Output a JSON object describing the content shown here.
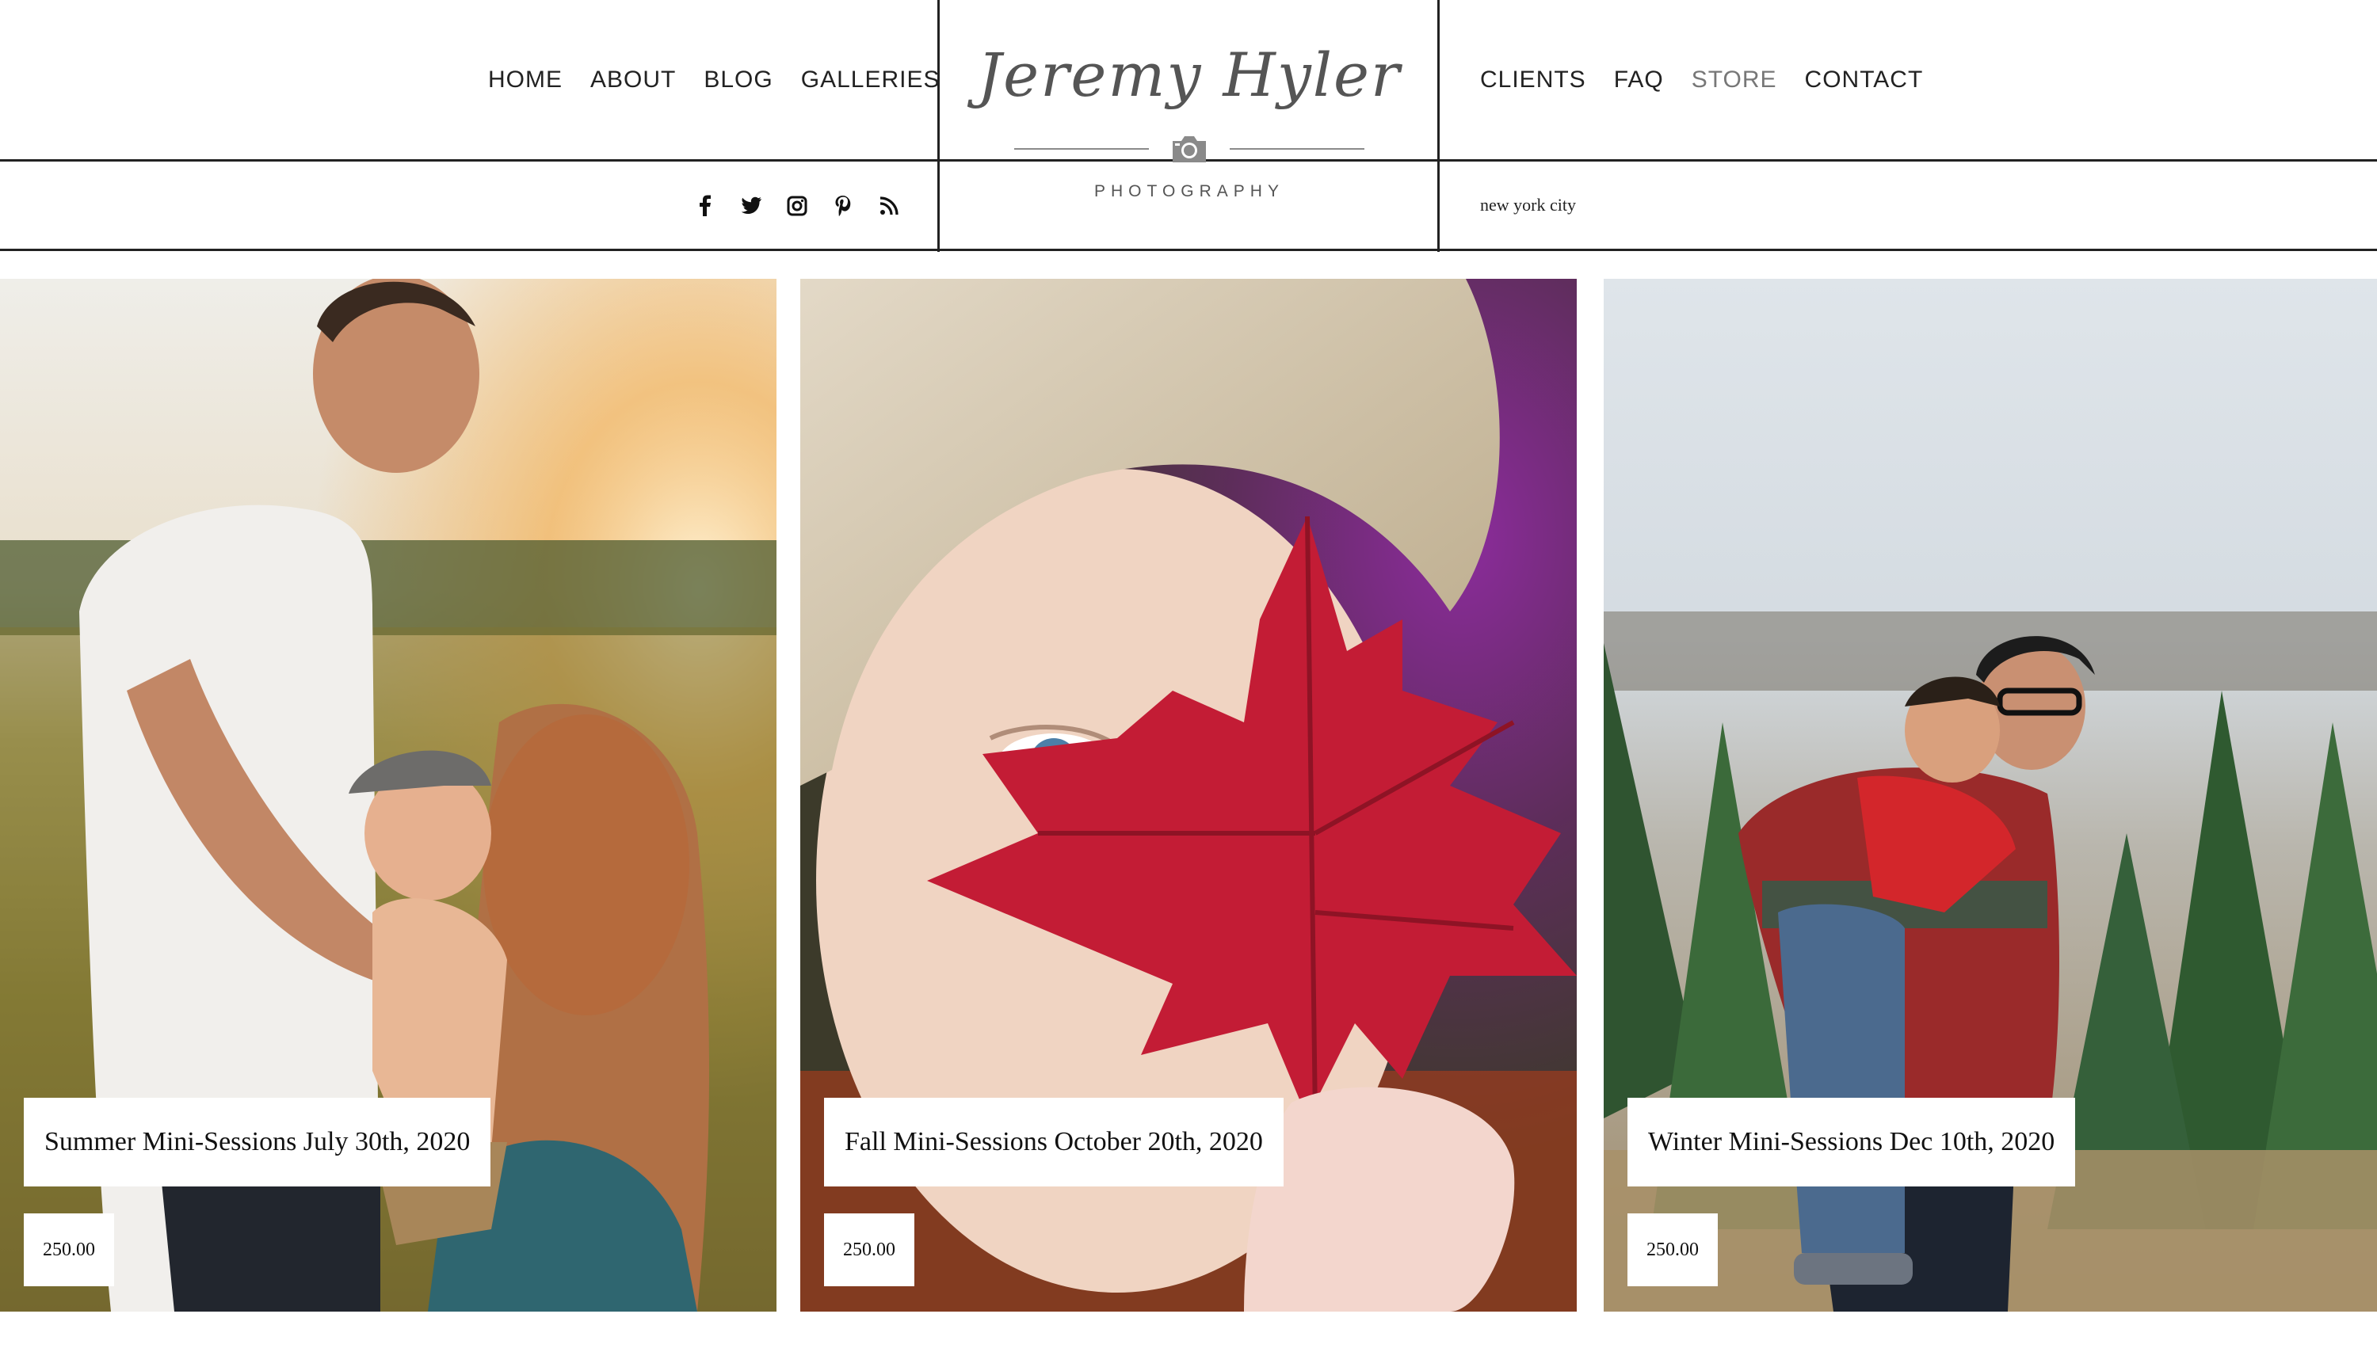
{
  "brand": {
    "script": "Jeremy Hyler",
    "subtitle": "PHOTOGRAPHY",
    "icon": "camera-icon"
  },
  "nav_left": [
    {
      "label": "HOME"
    },
    {
      "label": "ABOUT"
    },
    {
      "label": "BLOG"
    },
    {
      "label": "GALLERIES"
    }
  ],
  "nav_right": [
    {
      "label": "CLIENTS"
    },
    {
      "label": "FAQ"
    },
    {
      "label": "STORE",
      "active": true
    },
    {
      "label": "CONTACT"
    }
  ],
  "social_icons": [
    "facebook-icon",
    "twitter-icon",
    "instagram-icon",
    "pinterest-icon",
    "rss-icon"
  ],
  "location": "new york city",
  "products": [
    {
      "title": "Summer Mini-Sessions July 30th, 2020",
      "price": "250.00"
    },
    {
      "title": "Fall Mini-Sessions October 20th, 2020",
      "price": "250.00"
    },
    {
      "title": "Winter Mini-Sessions Dec 10th, 2020",
      "price": "250.00"
    }
  ],
  "colors": {
    "rule": "#222222",
    "nav_active": "#777777",
    "logo": "#555555"
  }
}
